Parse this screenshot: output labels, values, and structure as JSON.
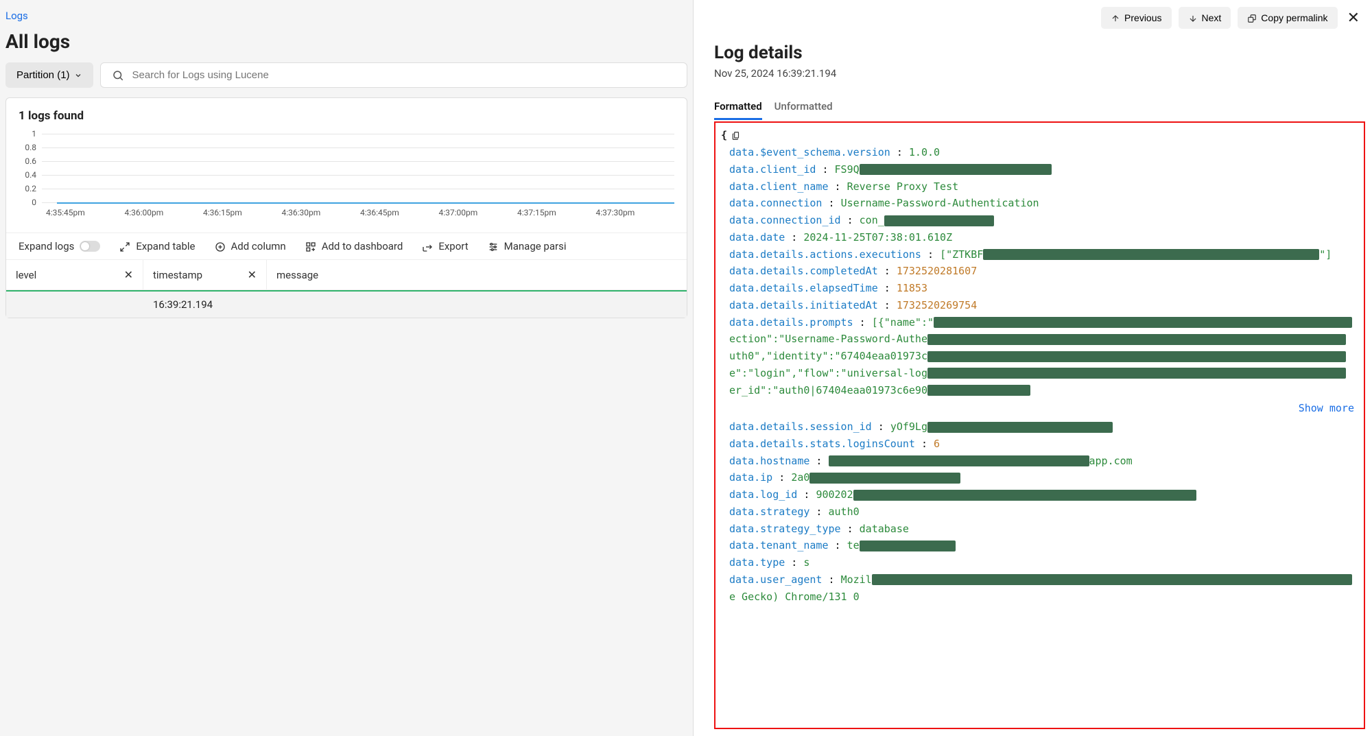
{
  "breadcrumb": {
    "logs": "Logs"
  },
  "page_title": "All logs",
  "partition": {
    "label": "Partition (1)"
  },
  "search": {
    "placeholder": "Search for Logs using Lucene"
  },
  "results": {
    "found_label": "1 logs found"
  },
  "chart_data": {
    "type": "line",
    "yticks": [
      "1",
      "0.8",
      "0.6",
      "0.4",
      "0.2",
      "0"
    ],
    "xticks": [
      "4:35:45pm",
      "4:36:00pm",
      "4:36:15pm",
      "4:36:30pm",
      "4:36:45pm",
      "4:37:00pm",
      "4:37:15pm",
      "4:37:30pm"
    ],
    "ylim": [
      0,
      1
    ]
  },
  "toolbar": {
    "expand_logs": "Expand logs",
    "expand_table": "Expand table",
    "add_column": "Add column",
    "add_dashboard": "Add to dashboard",
    "export": "Export",
    "manage_parsing": "Manage parsi"
  },
  "columns": {
    "level": "level",
    "timestamp": "timestamp",
    "message": "message"
  },
  "rows": [
    {
      "level": "",
      "timestamp": "16:39:21.194",
      "message": ""
    }
  ],
  "detail": {
    "top": {
      "previous": "Previous",
      "next": "Next",
      "copy": "Copy permalink"
    },
    "title": "Log details",
    "subtitle": "Nov 25, 2024 16:39:21.194",
    "tabs": {
      "formatted": "Formatted",
      "unformatted": "Unformatted"
    },
    "show_more": "Show more",
    "kv": {
      "schema_k": "data.$event_schema.version",
      "schema_v": "1.0.0",
      "client_id_k": "data.client_id",
      "client_id_v": "FS9Q",
      "client_name_k": "data.client_name",
      "client_name_v": "Reverse Proxy Test",
      "connection_k": "data.connection",
      "connection_v": "Username-Password-Authentication",
      "connection_id_k": "data.connection_id",
      "connection_id_v": "con_",
      "date_k": "data.date",
      "date_v": "2024-11-25T07:38:01.610Z",
      "exec_k": "data.details.actions.executions",
      "exec_v1": "[\"ZTKBF",
      "exec_v2": "\"]",
      "completed_k": "data.details.completedAt",
      "completed_v": "1732520281607",
      "elapsed_k": "data.details.elapsedTime",
      "elapsed_v": "11853",
      "initiated_k": "data.details.initiatedAt",
      "initiated_v": "1732520269754",
      "prompts_k": "data.details.prompts",
      "prompts_l1a": "[{\"name\":\"",
      "prompts_l2a": "ection\":\"Username-Password-Authe",
      "prompts_l3a": "uth0\",\"identity\":\"67404eaa01973c",
      "prompts_l4a": "e\":\"login\",\"flow\":\"universal-log",
      "prompts_l5a": "er_id\":\"auth0|67404eaa01973c6e90",
      "session_k": "data.details.session_id",
      "session_v": "yOf9Lg",
      "logins_k": "data.details.stats.loginsCount",
      "logins_v": "6",
      "hostname_k": "data.hostname",
      "hostname_suffix": "app.com",
      "ip_k": "data.ip",
      "ip_v": "2a0",
      "logid_k": "data.log_id",
      "logid_v": "900202",
      "strategy_k": "data.strategy",
      "strategy_v": "auth0",
      "strategy_type_k": "data.strategy_type",
      "strategy_type_v": "database",
      "tenant_k": "data.tenant_name",
      "tenant_v": "te",
      "type_k": "data.type",
      "type_v": "s",
      "ua_k": "data.user_agent",
      "ua_v": "Mozil",
      "ua_l2": "e Gecko) Chrome/131 0"
    }
  }
}
